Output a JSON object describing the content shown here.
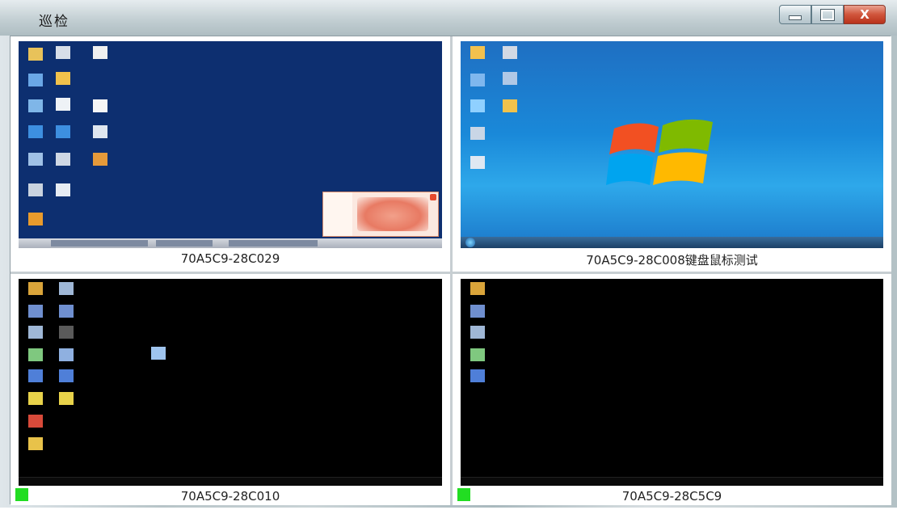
{
  "window": {
    "title": "巡检",
    "controls": {
      "minimize": "–",
      "maximize": "□",
      "close": "X"
    }
  },
  "colors": {
    "status_online": "#22dd22",
    "xp_desktop": "#0d2f70",
    "win7_desktop": "#1a89d9",
    "black_desktop": "#000000"
  },
  "cells": [
    {
      "label": "70A5C9-28C029",
      "screen": "xp-desktop",
      "status": null
    },
    {
      "label": "70A5C9-28C008键盘鼠标测试",
      "screen": "win7-desktop",
      "status": null
    },
    {
      "label": "70A5C9-28C010",
      "screen": "black-desktop",
      "status": "online"
    },
    {
      "label": "70A5C9-28C5C9",
      "screen": "black-desktop",
      "status": "online"
    }
  ]
}
